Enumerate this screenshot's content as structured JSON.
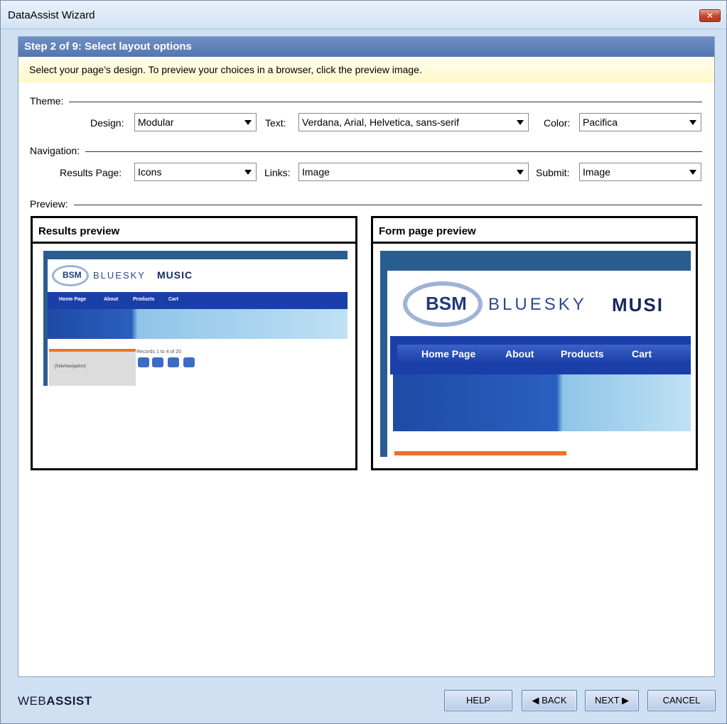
{
  "window": {
    "title": "DataAssist Wizard",
    "close_glyph": "✕"
  },
  "step": {
    "title": "Step 2 of 9: Select layout options"
  },
  "intro": {
    "text": "Select your page’s design. To preview your choices in a browser, click the preview image."
  },
  "theme": {
    "section_label": "Theme:",
    "design_label": "Design:",
    "design_value": "Modular",
    "text_label": "Text:",
    "text_value": "Verdana, Arial, Helvetica, sans-serif",
    "color_label": "Color:",
    "color_value": "Pacifica"
  },
  "navigation": {
    "section_label": "Navigation:",
    "results_label": "Results Page:",
    "results_value": "Icons",
    "links_label": "Links:",
    "links_value": "Image",
    "submit_label": "Submit:",
    "submit_value": "Image"
  },
  "preview": {
    "section_label": "Preview:",
    "results_title": "Results preview",
    "form_title": "Form page preview",
    "brand_light": "BLUESKY",
    "brand_bold": "MUSIC",
    "brand_bold_cropped": "MUSI",
    "logo_text": "BSM",
    "nav_items": [
      "Home Page",
      "About",
      "Products",
      "Cart"
    ],
    "records_text": "Records 1 to 4 of 20",
    "side_nav_text": "[SideNavigation]",
    "pager_icons": [
      "first-icon",
      "prev-icon",
      "next-icon",
      "last-icon"
    ]
  },
  "footer": {
    "logo_light": "WEB",
    "logo_bold": "ASSIST",
    "help": "HELP",
    "back": "◀ BACK",
    "next": "NEXT ▶",
    "cancel": "CANCEL"
  },
  "colors": {
    "step_bar": "#5f82bc",
    "site_nav": "#1b3fa8",
    "site_accent": "#e9742a",
    "site_sky": "#8ec5e8"
  }
}
